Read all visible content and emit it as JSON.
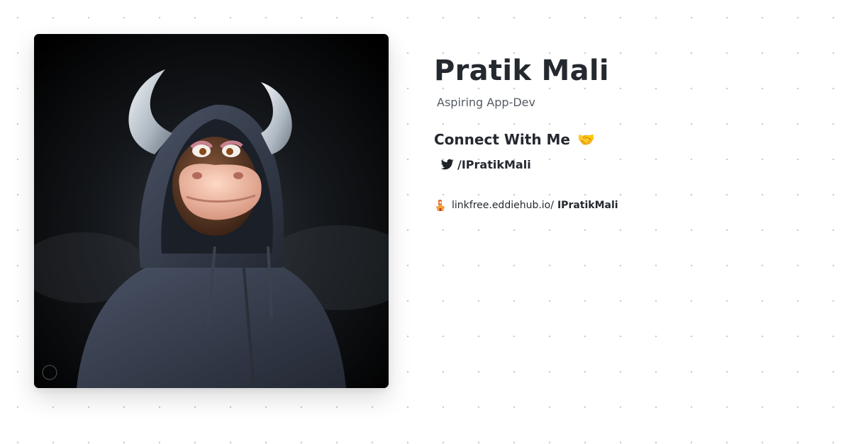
{
  "profile": {
    "name": "Pratik Mali",
    "tagline": "Aspiring App-Dev",
    "avatar_icon": "profile-avatar-bull-hoodie"
  },
  "connect": {
    "title": "Connect With Me",
    "emoji": "🤝",
    "twitter": {
      "icon": "twitter-icon",
      "handle": "/IPratikMali"
    }
  },
  "linkfree": {
    "icon": "linkfree-logo-icon",
    "domain": "linkfree.eddiehub.io/",
    "username": "IPratikMali"
  },
  "colors": {
    "text": "#24292f",
    "muted": "#555b63",
    "twitter_icon": "#1f2328",
    "background": "#ffffff",
    "dot_grid": "#c9c9c9"
  }
}
